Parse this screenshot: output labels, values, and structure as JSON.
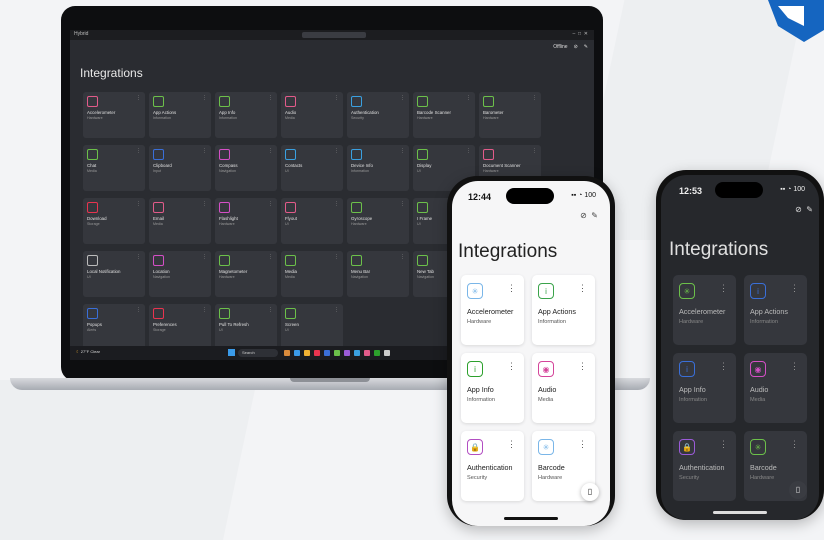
{
  "brand": {
    "logo_color": "#1565c0"
  },
  "desktop": {
    "app_title": "Hybrid",
    "status_offline": "Offline",
    "page_title": "Integrations",
    "tiles": [
      {
        "name": "Accelerometer",
        "category": "Hardware",
        "color": "#e25b8a",
        "icon": "accelerometer-icon"
      },
      {
        "name": "App Actions",
        "category": "Information",
        "color": "#6cc04a",
        "icon": "info-icon"
      },
      {
        "name": "App Info",
        "category": "Information",
        "color": "#6cc04a",
        "icon": "info-icon"
      },
      {
        "name": "Audio",
        "category": "Media",
        "color": "#e25b8a",
        "icon": "audio-icon"
      },
      {
        "name": "Authentication",
        "category": "Security",
        "color": "#3aa0e0",
        "icon": "lock-icon"
      },
      {
        "name": "Barcode Scanner",
        "category": "Hardware",
        "color": "#6cc04a",
        "icon": "barcode-icon"
      },
      {
        "name": "Barometer",
        "category": "Hardware",
        "color": "#6cc04a",
        "icon": "barometer-icon"
      },
      {
        "name": "Chat",
        "category": "Media",
        "color": "#6cc04a",
        "icon": "camera-icon"
      },
      {
        "name": "Clipboard",
        "category": "Input",
        "color": "#3a6fd8",
        "icon": "clipboard-icon"
      },
      {
        "name": "Compass",
        "category": "Navigation",
        "color": "#d44fc6",
        "icon": "compass-icon"
      },
      {
        "name": "Contacts",
        "category": "UI",
        "color": "#3aa0e0",
        "icon": "contacts-icon"
      },
      {
        "name": "Device Info",
        "category": "Information",
        "color": "#3aa0e0",
        "icon": "info-icon"
      },
      {
        "name": "Display",
        "category": "UI",
        "color": "#6cc04a",
        "icon": "display-icon"
      },
      {
        "name": "Document Scanner",
        "category": "Hardware",
        "color": "#e25b8a",
        "icon": "scanner-icon"
      },
      {
        "name": "Download",
        "category": "Storage",
        "color": "#e8344f",
        "icon": "download-icon"
      },
      {
        "name": "Email",
        "category": "Media",
        "color": "#e25b8a",
        "icon": "email-icon"
      },
      {
        "name": "Flashlight",
        "category": "Hardware",
        "color": "#d44fc6",
        "icon": "flashlight-icon"
      },
      {
        "name": "Flyout",
        "category": "UI",
        "color": "#e25b8a",
        "icon": "flyout-icon"
      },
      {
        "name": "Gyroscope",
        "category": "Hardware",
        "color": "#6cc04a",
        "icon": "gyroscope-icon"
      },
      {
        "name": "I Frame",
        "category": "UI",
        "color": "#6cc04a",
        "icon": "iframe-icon"
      },
      {
        "name": "Links",
        "category": "Input",
        "color": "#e2a53b",
        "icon": "link-icon"
      },
      {
        "name": "Local Notification",
        "category": "UI",
        "color": "#bbbbbb",
        "icon": "notification-icon"
      },
      {
        "name": "Location",
        "category": "Navigation",
        "color": "#d44fc6",
        "icon": "location-icon"
      },
      {
        "name": "Magnetometer",
        "category": "Hardware",
        "color": "#6cc04a",
        "icon": "magnet-icon"
      },
      {
        "name": "Media",
        "category": "Media",
        "color": "#6cc04a",
        "icon": "media-icon"
      },
      {
        "name": "Menu Bar",
        "category": "Navigation",
        "color": "#6cc04a",
        "icon": "menu-icon"
      },
      {
        "name": "New Tab",
        "category": "Navigation",
        "color": "#6cc04a",
        "icon": "tab-icon"
      },
      {
        "name": "Permissions",
        "category": "Permissions",
        "color": "#e2c53b",
        "icon": "permissions-icon"
      },
      {
        "name": "Popups",
        "category": "Alerts",
        "color": "#3a6fd8",
        "icon": "popup-icon"
      },
      {
        "name": "Preferences",
        "category": "Storage",
        "color": "#e8344f",
        "icon": "preferences-icon"
      },
      {
        "name": "Pull To Refresh",
        "category": "UI",
        "color": "#6cc04a",
        "icon": "refresh-icon"
      },
      {
        "name": "Screen",
        "category": "UI",
        "color": "#6cc04a",
        "icon": "screen-icon"
      }
    ],
    "taskbar": {
      "weather_temp": "27°F",
      "weather_desc": "Clear",
      "search_label": "Search"
    }
  },
  "phone_light": {
    "time": "12:44",
    "battery": "100",
    "title": "Integrations",
    "tiles": [
      {
        "name": "Accelerometer",
        "category": "Hardware",
        "color": "#7ab6e8",
        "glyph": "✳"
      },
      {
        "name": "App Actions",
        "category": "Information",
        "color": "#3aa34a",
        "glyph": "i"
      },
      {
        "name": "App Info",
        "category": "Information",
        "color": "#2ca02c",
        "glyph": "i"
      },
      {
        "name": "Audio",
        "category": "Media",
        "color": "#d4459a",
        "glyph": "◉"
      },
      {
        "name": "Authentication",
        "category": "Security",
        "color": "#b24ec2",
        "glyph": "🔒"
      },
      {
        "name": "Barcode",
        "category": "Hardware",
        "color": "#7ab6e8",
        "glyph": "✳"
      }
    ]
  },
  "phone_dark": {
    "time": "12:53",
    "battery": "100",
    "title": "Integrations",
    "tiles": [
      {
        "name": "Accelerometer",
        "category": "Hardware",
        "color": "#6cc04a",
        "glyph": "✳"
      },
      {
        "name": "App Actions",
        "category": "Information",
        "color": "#3a6fd8",
        "glyph": "i"
      },
      {
        "name": "App Info",
        "category": "Information",
        "color": "#3a6fd8",
        "glyph": "i"
      },
      {
        "name": "Audio",
        "category": "Media",
        "color": "#d44fc6",
        "glyph": "◉"
      },
      {
        "name": "Authentication",
        "category": "Security",
        "color": "#9b5bd8",
        "glyph": "🔒"
      },
      {
        "name": "Barcode",
        "category": "Hardware",
        "color": "#6cc04a",
        "glyph": "✳"
      }
    ]
  }
}
